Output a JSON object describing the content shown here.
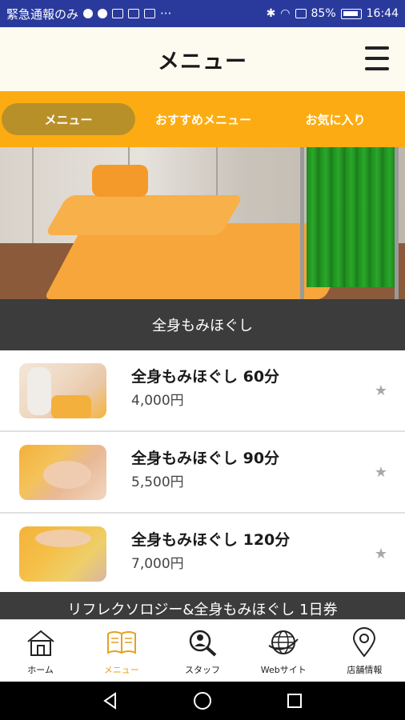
{
  "status_bar": {
    "left_text": "緊急通報のみ",
    "more": "···",
    "battery": "85%",
    "time": "16:44"
  },
  "header": {
    "title": "メニュー"
  },
  "tabs": [
    {
      "label": "メニュー",
      "active": true
    },
    {
      "label": "おすすめメニュー",
      "active": false
    },
    {
      "label": "お気に入り",
      "active": false
    }
  ],
  "section": {
    "title": "全身もみほぐし",
    "next_title": "リフレクソロジー&全身もみほぐし 1日券"
  },
  "menu_items": [
    {
      "name": "全身もみほぐし 60分",
      "price": "4,000円"
    },
    {
      "name": "全身もみほぐし 90分",
      "price": "5,500円"
    },
    {
      "name": "全身もみほぐし 120分",
      "price": "7,000円"
    }
  ],
  "bottom_nav": [
    {
      "label": "ホーム",
      "icon": "home-icon",
      "active": false
    },
    {
      "label": "メニュー",
      "icon": "book-icon",
      "active": true
    },
    {
      "label": "スタッフ",
      "icon": "staff-search-icon",
      "active": false
    },
    {
      "label": "Webサイト",
      "icon": "globe-icon",
      "active": false
    },
    {
      "label": "店舗情報",
      "icon": "location-pin-icon",
      "active": false
    }
  ],
  "colors": {
    "accent": "#fcac12",
    "active_tab": "#b8902a",
    "section_bg": "#3c3c3c",
    "status_bar": "#2a3a9c"
  }
}
